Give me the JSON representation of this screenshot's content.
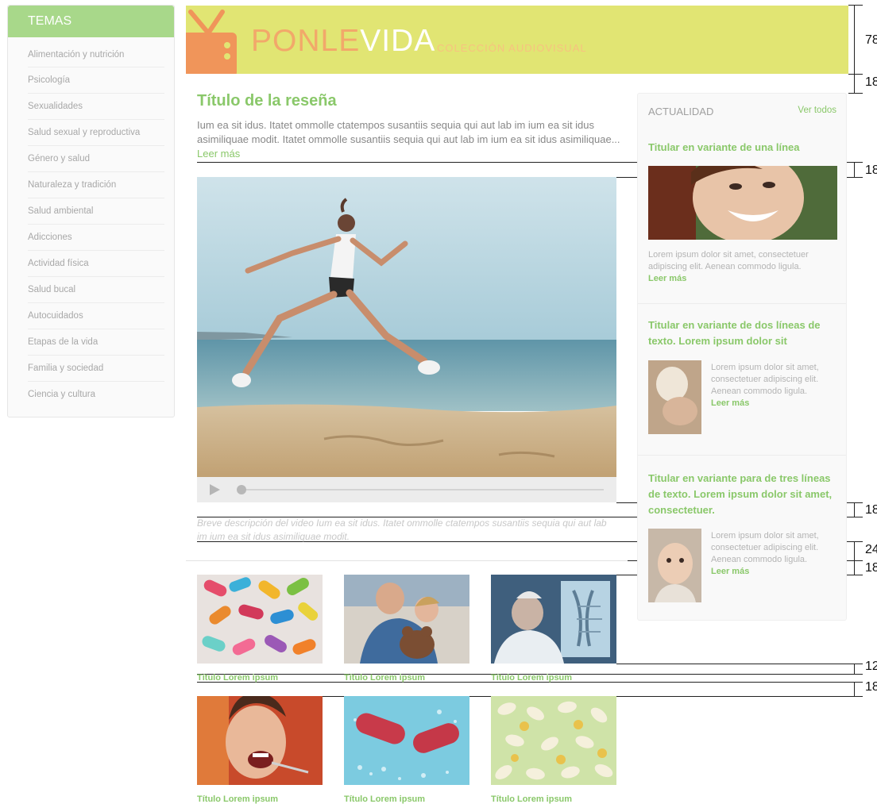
{
  "sidebar": {
    "title": "TEMAS",
    "items": [
      {
        "label": "Alimentación y nutrición"
      },
      {
        "label": "Psicología"
      },
      {
        "label": "Sexualidades"
      },
      {
        "label": "Salud sexual y reproductiva"
      },
      {
        "label": "Género y salud"
      },
      {
        "label": "Naturaleza y tradición"
      },
      {
        "label": "Salud ambiental"
      },
      {
        "label": "Adicciones"
      },
      {
        "label": "Actividad física"
      },
      {
        "label": "Salud bucal"
      },
      {
        "label": "Autocuidados"
      },
      {
        "label": "Etapas de la vida"
      },
      {
        "label": "Familia y sociedad"
      },
      {
        "label": "Ciencia y cultura"
      }
    ]
  },
  "banner": {
    "brand_a": "PONLE",
    "brand_b": "VIDA",
    "subtitle": "COLECCIÓN AUDIOVISUAL",
    "colors": {
      "bg": "#e1e573",
      "orange": "#f2a86a",
      "tv": "#f0955a"
    }
  },
  "measurements": [
    "78",
    "18",
    "18",
    "18",
    "24",
    "18",
    "12",
    "18"
  ],
  "review": {
    "title": "Título de la reseña",
    "text": "Ium ea sit idus. Itatet ommolle ctatempos susantiis sequia qui aut lab im ium ea sit idus asimiliquae modit. Itatet ommolle  susantiis sequia qui aut lab im ium ea sit idus asimiliquae...",
    "more": "Leer más",
    "video_desc": "Breve descripción del video Ium ea sit idus. Itatet ommolle ctatempos susantiis sequia qui aut lab im ium ea sit idus asimiliquae modit."
  },
  "video": {
    "progress": 0
  },
  "thumbs": [
    {
      "title": "Título Lorem ipsum",
      "icon": "pills-photo"
    },
    {
      "title": "Título Lorem ipsum",
      "icon": "mother-child-photo"
    },
    {
      "title": "Título Lorem ipsum",
      "icon": "xray-doctor-photo"
    },
    {
      "title": "Título Lorem ipsum",
      "icon": "dental-photo"
    },
    {
      "title": "Título Lorem ipsum",
      "icon": "capsule-photo"
    },
    {
      "title": "Título Lorem ipsum",
      "icon": "tablets-photo"
    }
  ],
  "news": {
    "header": "ACTUALIDAD",
    "see_all": "Ver todos",
    "items": [
      {
        "title": "Titular en variante de una línea",
        "text": "Lorem ipsum dolor sit amet, consectetuer adipiscing elit. Aenean commodo ligula.",
        "more": "Leer más"
      },
      {
        "title": "Titular en variante de dos líneas de texto. Lorem ipsum dolor sit",
        "text": "Lorem ipsum dolor sit amet, consectetuer adipiscing elit. Aenean commodo ligula.",
        "more": "Leer más"
      },
      {
        "title": "Titular en variante para de tres líneas de texto. Lorem ipsum dolor sit amet, consectetuer.",
        "text": "Lorem ipsum dolor sit amet, consectetuer adipiscing elit. Aenean commodo ligula.",
        "more": "Leer más"
      }
    ]
  }
}
